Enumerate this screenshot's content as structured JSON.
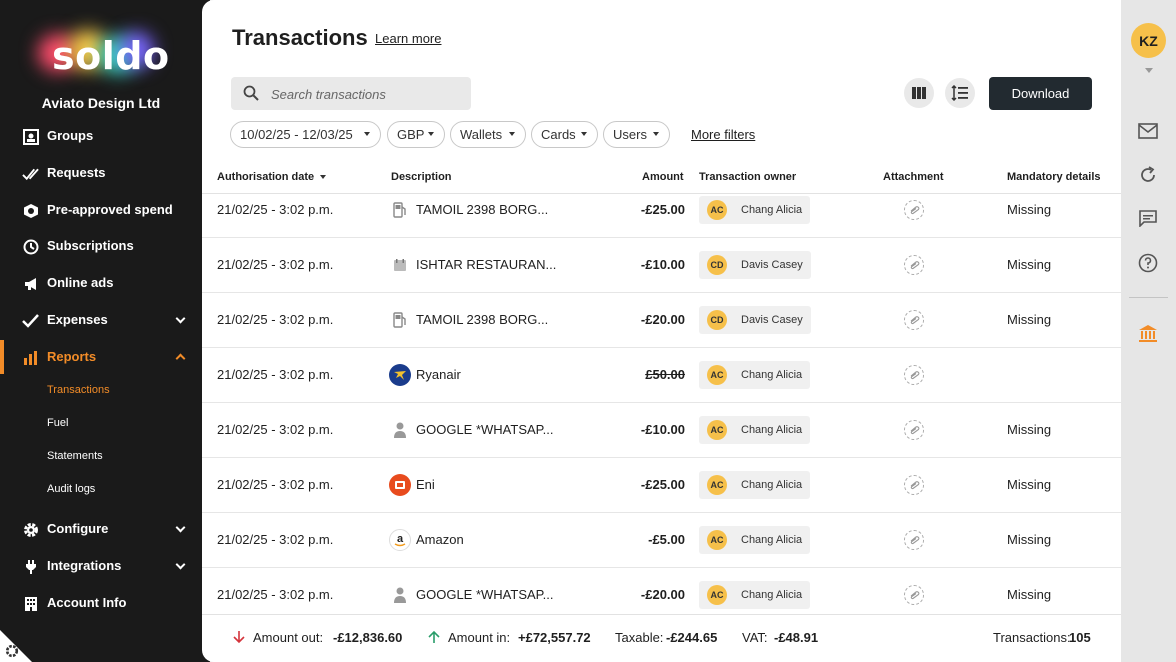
{
  "colors": {
    "accent": "#f28c28",
    "sidebar_bg": "#1a1a1a",
    "avatar": "#f6c04a"
  },
  "sidebar": {
    "logo_text": "soldo",
    "company": "Aviato Design Ltd",
    "items": [
      {
        "label": "Groups",
        "icon": "groups-icon"
      },
      {
        "label": "Requests",
        "icon": "requests-icon"
      },
      {
        "label": "Pre-approved spend",
        "icon": "shield-icon"
      },
      {
        "label": "Subscriptions",
        "icon": "clock-icon"
      },
      {
        "label": "Online ads",
        "icon": "megaphone-icon"
      },
      {
        "label": "Expenses",
        "icon": "check-icon"
      },
      {
        "label": "Reports",
        "icon": "bar-chart-icon"
      },
      {
        "label": "Configure",
        "icon": "gear-icon"
      },
      {
        "label": "Integrations",
        "icon": "plug-icon"
      },
      {
        "label": "Account Info",
        "icon": "building-icon"
      }
    ],
    "report_subitems": [
      "Transactions",
      "Fuel",
      "Statements",
      "Audit logs"
    ]
  },
  "header": {
    "title": "Transactions",
    "learn_more": "Learn more",
    "download": "Download"
  },
  "search": {
    "placeholder": "Search transactions"
  },
  "filters": {
    "date": "10/02/25 - 12/03/25",
    "currency": "GBP",
    "wallets": "Wallets",
    "cards": "Cards",
    "users": "Users",
    "more": "More filters"
  },
  "table": {
    "headers": {
      "date": "Authorisation date",
      "description": "Description",
      "amount": "Amount",
      "owner": "Transaction owner",
      "attachment": "Attachment",
      "mandatory": "Mandatory details"
    },
    "rows": [
      {
        "date": "21/02/25 - 3:02 p.m.",
        "icon": "fuel-pump-icon",
        "description": "TAMOIL 2398 BORG...",
        "amount": "-£25.00",
        "initials": "AC",
        "owner": "Chang Alicia",
        "mandatory": "Missing"
      },
      {
        "date": "21/02/25 - 3:02 p.m.",
        "icon": "restaurant-icon",
        "description": "ISHTAR RESTAURAN...",
        "amount": "-£10.00",
        "initials": "CD",
        "owner": "Davis Casey",
        "mandatory": "Missing"
      },
      {
        "date": "21/02/25 - 3:02 p.m.",
        "icon": "fuel-pump-icon",
        "description": "TAMOIL 2398 BORG...",
        "amount": "-£20.00",
        "initials": "CD",
        "owner": "Davis Casey",
        "mandatory": "Missing"
      },
      {
        "date": "21/02/25 - 3:02 p.m.",
        "icon": "ryanair-logo-icon",
        "description": "Ryanair",
        "amount": "£50.00",
        "initials": "AC",
        "owner": "Chang Alicia",
        "mandatory": ""
      },
      {
        "date": "21/02/25 - 3:02 p.m.",
        "icon": "person-icon",
        "description": "GOOGLE *WHATSAP...",
        "amount": "-£10.00",
        "initials": "AC",
        "owner": "Chang Alicia",
        "mandatory": "Missing"
      },
      {
        "date": "21/02/25 - 3:02 p.m.",
        "icon": "eni-logo-icon",
        "description": "Eni",
        "amount": "-£25.00",
        "initials": "AC",
        "owner": "Chang Alicia",
        "mandatory": "Missing"
      },
      {
        "date": "21/02/25 - 3:02 p.m.",
        "icon": "amazon-logo-icon",
        "description": "Amazon",
        "amount": "-£5.00",
        "initials": "AC",
        "owner": "Chang Alicia",
        "mandatory": "Missing"
      },
      {
        "date": "21/02/25 - 3:02 p.m.",
        "icon": "person-icon",
        "description": "GOOGLE *WHATSAP...",
        "amount": "-£20.00",
        "initials": "AC",
        "owner": "Chang Alicia",
        "mandatory": "Missing"
      }
    ]
  },
  "footer": {
    "out_label": "Amount out:",
    "out_value": "-£12,836.60",
    "in_label": "Amount in:",
    "in_value": "+£72,557.72",
    "taxable_label": "Taxable:",
    "taxable_value": "-£244.65",
    "vat_label": "VAT:",
    "vat_value": "-£48.91",
    "count_label": "Transactions:",
    "count_value": "105"
  },
  "user": {
    "initials": "KZ"
  }
}
